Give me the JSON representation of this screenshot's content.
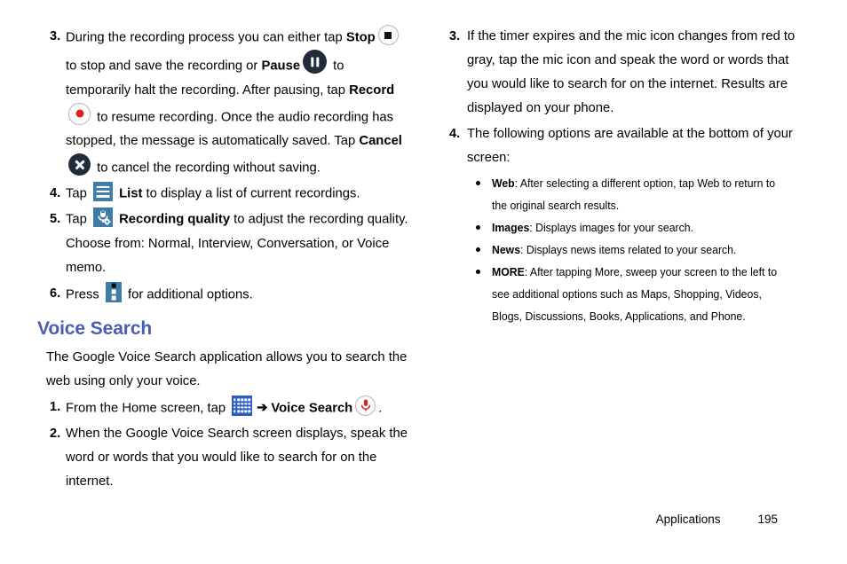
{
  "document": {
    "footer": {
      "chapter": "Applications",
      "page_number": "195"
    }
  },
  "left_column": {
    "steps": [
      {
        "number": "3.",
        "segments": [
          {
            "type": "text",
            "value": "During the recording process you can either tap "
          },
          {
            "type": "bold",
            "value": "Stop"
          },
          {
            "type": "icon",
            "value": "stop-icon"
          },
          {
            "type": "text",
            "value": " to stop and save the recording or "
          },
          {
            "type": "bold",
            "value": "Pause"
          },
          {
            "type": "icon",
            "value": "pause-icon"
          },
          {
            "type": "text",
            "value": " to temporarily halt the recording. After pausing, tap "
          },
          {
            "type": "bold",
            "value": "Record"
          },
          {
            "type": "icon",
            "value": "record-icon"
          },
          {
            "type": "text",
            "value": " to resume recording. Once the audio recording has stopped, the message is automatically saved. Tap "
          },
          {
            "type": "bold",
            "value": "Cancel"
          },
          {
            "type": "icon",
            "value": "cancel-icon"
          },
          {
            "type": "text",
            "value": " to cancel the recording without saving."
          }
        ]
      },
      {
        "number": "4.",
        "segments": [
          {
            "type": "text",
            "value": "Tap "
          },
          {
            "type": "icon",
            "value": "list-icon"
          },
          {
            "type": "bold",
            "value": "List"
          },
          {
            "type": "text",
            "value": " to display a list of current recordings."
          }
        ]
      },
      {
        "number": "5.",
        "segments": [
          {
            "type": "text",
            "value": "Tap "
          },
          {
            "type": "icon",
            "value": "recording-quality-icon"
          },
          {
            "type": "bold",
            "value": "Recording quality"
          },
          {
            "type": "text",
            "value": " to adjust the recording quality. Choose from: Normal, Interview, Conversation, or Voice memo."
          }
        ]
      },
      {
        "number": "6.",
        "segments": [
          {
            "type": "text",
            "value": "Press "
          },
          {
            "type": "icon",
            "value": "more-options-icon"
          },
          {
            "type": "text",
            "value": " for additional options."
          }
        ]
      }
    ],
    "heading": "Voice Search",
    "heading_color": "#4a5cb8",
    "intro": "The Google Voice Search application allows you to search the web using only your voice.",
    "voice_steps": [
      {
        "number": "1.",
        "segments": [
          {
            "type": "text",
            "value": "From the Home screen, tap "
          },
          {
            "type": "icon",
            "value": "apps-grid-icon"
          },
          {
            "type": "arrow",
            "value": "➔"
          },
          {
            "type": "bold",
            "value": "Voice Search"
          },
          {
            "type": "icon",
            "value": "voice-search-mic-icon"
          },
          {
            "type": "text",
            "value": "."
          }
        ]
      },
      {
        "number": "2.",
        "segments": [
          {
            "type": "text",
            "value": " When the Google Voice Search screen displays, speak the word or words that you would like to search for on the internet."
          }
        ]
      }
    ]
  },
  "right_column": {
    "steps": [
      {
        "number": "3.",
        "text": "If the timer expires and the mic icon changes from red to gray, tap the mic icon and speak the word or words that you would like to search for on the internet.  Results are displayed on your phone."
      },
      {
        "number": "4.",
        "text": "The following options are available at the bottom of your screen:"
      }
    ],
    "bullets": [
      {
        "label": "Web",
        "text": ": After selecting a different option, tap Web to return to the original search results."
      },
      {
        "label": "Images",
        "text": ": Displays images for your search."
      },
      {
        "label": "News",
        "text": ": Displays news items related to your search."
      },
      {
        "label": "MORE",
        "text": ": After tapping More, sweep your screen to the left to see additional options such as Maps, Shopping, Videos, Blogs, Discussions, Books, Applications, and Phone."
      }
    ]
  },
  "colors": {
    "heading": "#4a5cb8",
    "icon_blue": "#3c7ca5",
    "apps_blue": "#2b5cc4",
    "dark_circle": "#222b3a",
    "record_red": "#e02020"
  }
}
